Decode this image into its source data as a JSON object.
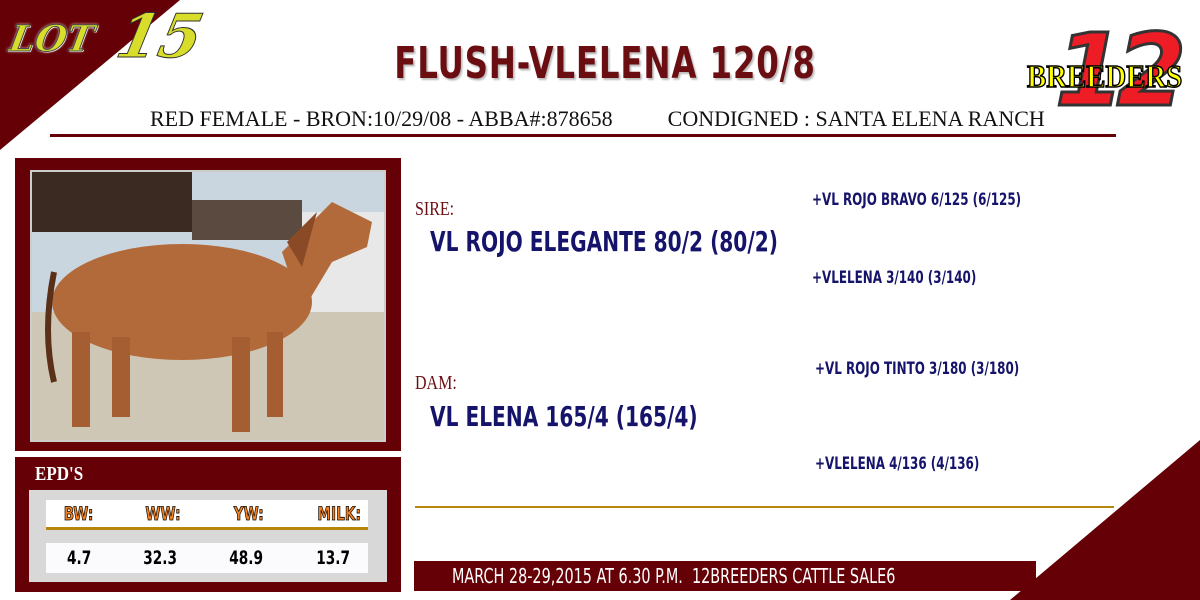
{
  "lot": {
    "word": "LOT",
    "number": "15"
  },
  "title": "FLUSH-VLELENA 120/8",
  "subtitle": {
    "info": "RED FEMALE - BRON:10/29/08 - ABBA#:878658",
    "consigned": "CONDIGNED : SANTA ELENA RANCH"
  },
  "logo": {
    "number": "12",
    "text": "BREEDERS"
  },
  "epd": {
    "title": "EPD'S",
    "headers": [
      "BW:",
      "WW:",
      "YW:",
      "MILK:"
    ],
    "values": [
      "4.7",
      "32.3",
      "48.9",
      "13.7"
    ]
  },
  "pedigree": {
    "sire_label": "SIRE:",
    "sire": "VL ROJO ELEGANTE 80/2 (80/2)",
    "sire_sire": "+VL ROJO BRAVO 6/125 (6/125)",
    "sire_dam": "+VLELENA 3/140 (3/140)",
    "dam_label": "DAM:",
    "dam": "VL ELENA 165/4 (165/4)",
    "dam_sire": "+VL ROJO TINTO 3/180 (3/180)",
    "dam_dam": "+VLELENA 4/136 (4/136)"
  },
  "banner": "MARCH 28-29,2015 AT 6.30 P.M.  12BREEDERS CATTLE SALE6",
  "colors": {
    "maroon": "#650006",
    "navy": "#15136a",
    "gold": "#b8860b",
    "orange": "#f58220"
  }
}
